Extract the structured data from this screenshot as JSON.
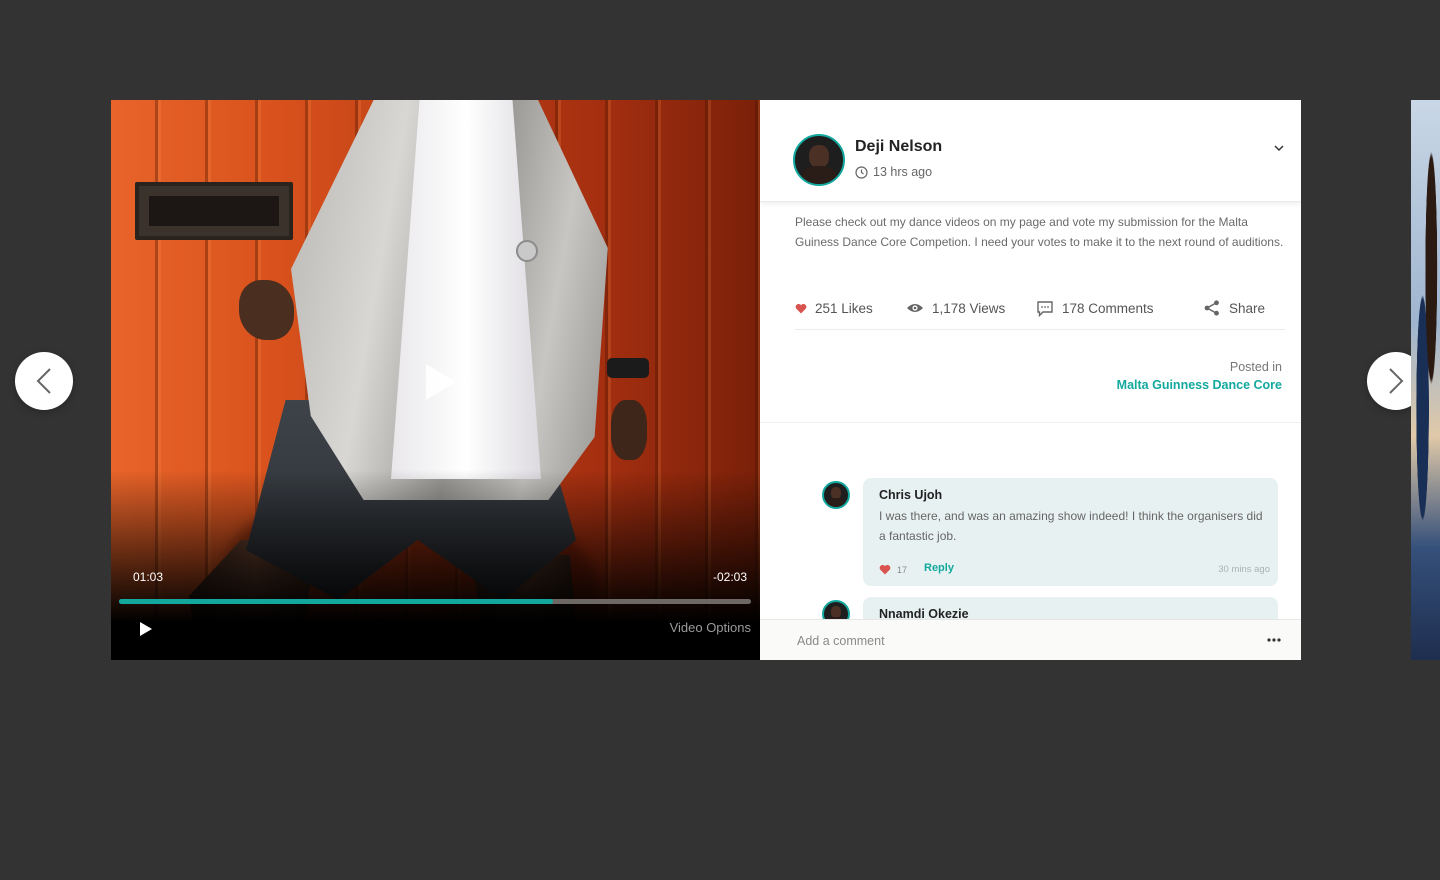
{
  "video": {
    "current_time": "01:03",
    "remaining_time": "-02:03",
    "progress": 0.686,
    "options_label": "Video Options"
  },
  "post": {
    "author": "Deji Nelson",
    "time_ago": "13 hrs ago",
    "body": "Please check out my dance videos on my page and vote my submission for the Malta Guiness Dance Core Competion. I need your votes to make it to the next round of auditions.",
    "stats": {
      "likes": "251 Likes",
      "views": "1,178 Views",
      "comments": "178 Comments",
      "share": "Share"
    },
    "posted_in_label": "Posted in",
    "posted_in_group": "Malta Guinness Dance Core"
  },
  "comments": [
    {
      "name": "Chris Ujoh",
      "text": "I was there, and was an amazing show indeed! I think the organisers did a fantastic job.",
      "likes": "17",
      "reply_label": "Reply",
      "time": "30 mins ago"
    },
    {
      "name": "Nnamdi Okezie"
    }
  ],
  "comment_box": {
    "placeholder": "Add a comment"
  },
  "colors": {
    "accent": "#13a89e",
    "like": "#d9534f",
    "background": "#333333"
  },
  "icons": [
    "chevron-left-icon",
    "chevron-right-icon",
    "play-icon",
    "clock-icon",
    "chevron-down-icon",
    "heart-icon",
    "eye-icon",
    "comment-icon",
    "share-icon",
    "more-icon"
  ]
}
